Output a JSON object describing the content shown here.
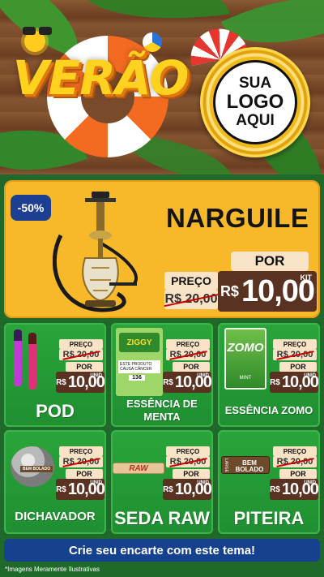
{
  "header": {
    "title": "VERÃO",
    "logo_placeholder": {
      "line1": "SUA",
      "line2": "LOGO",
      "line3": "AQUI"
    }
  },
  "featured": {
    "discount_badge": "-50%",
    "name": "NARGUILE",
    "por_label": "POR",
    "preco_label": "PREÇO",
    "old_price": "R$ 20,00",
    "currency": "R$",
    "new_price": "10,00",
    "unit_label": "KIT"
  },
  "products": [
    {
      "name": "POD",
      "preco_label": "PREÇO",
      "old_price": "R$ 20,00",
      "por_label": "POR",
      "currency": "R$",
      "new_price": "10,00",
      "unit_label": "UNID"
    },
    {
      "name": "ESSÊNCIA DE MENTA",
      "preco_label": "PREÇO",
      "old_price": "R$ 20,00",
      "por_label": "POR",
      "currency": "R$",
      "new_price": "10,00",
      "unit_label": "UNID",
      "pack_text": {
        "brand": "ZIGGY",
        "warning": "ESTE PRODUTO CAUSA CÂNCER",
        "code": "136"
      }
    },
    {
      "name": "ESSÊNCIA ZOMO",
      "preco_label": "PREÇO",
      "old_price": "R$ 20,00",
      "por_label": "POR",
      "currency": "R$",
      "new_price": "10,00",
      "unit_label": "UNID",
      "pack_text": {
        "brand": "ZOMO",
        "flavor": "MINT"
      }
    },
    {
      "name": "DICHAVADOR",
      "preco_label": "PREÇO",
      "old_price": "R$ 20,00",
      "por_label": "POR",
      "currency": "R$",
      "new_price": "10,00",
      "unit_label": "UNID",
      "pack_text": {
        "brand": "BEM BOLADO"
      }
    },
    {
      "name": "SEDA RAW",
      "preco_label": "PREÇO",
      "old_price": "R$ 20,00",
      "por_label": "POR",
      "currency": "R$",
      "new_price": "10,00",
      "unit_label": "UNID",
      "pack_text": {
        "brand": "RAW"
      }
    },
    {
      "name": "PITEIRA",
      "preco_label": "PREÇO",
      "old_price": "R$ 20,00",
      "por_label": "POR",
      "currency": "R$",
      "new_price": "10,00",
      "unit_label": "UNID",
      "pack_text": {
        "brand": "BEM BOLADO",
        "size": "LARGE"
      }
    }
  ],
  "footer": {
    "cta": "Crie seu encarte com este tema!",
    "disclaimer": "*Imagens Meramente Ilustrativas"
  },
  "colors": {
    "accent_yellow": "#f7b92a",
    "price_brown": "#5a3221",
    "card_green": "#2aa53a",
    "cta_blue": "#16418f"
  }
}
